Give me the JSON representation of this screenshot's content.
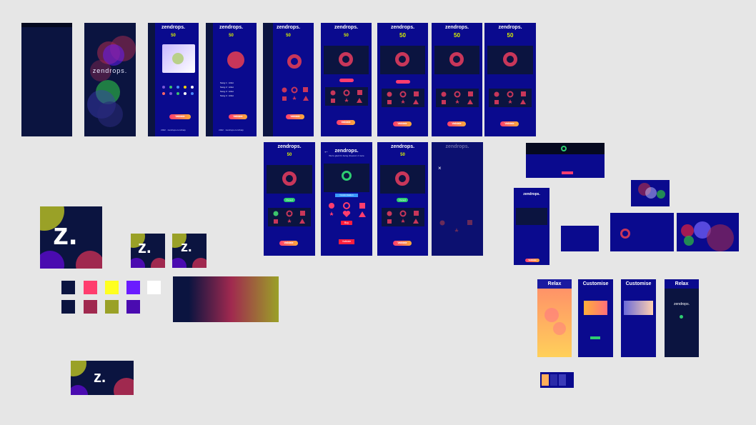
{
  "brand": {
    "name": "zendrops.",
    "logo_letter": "z.",
    "accent": "#0a0a8e",
    "dark": "#0b1440"
  },
  "screens": {
    "coins_small": "50",
    "coins_large": "50",
    "subtitle": "Tap to start falling. Take",
    "buy_label": "Buy",
    "validate_label": "Validate",
    "owned_label": "Owned",
    "footer": "2022 · zendrops.com/help",
    "customise_header": "Customise",
    "customise_header_2": "Customise",
    "relax_header": "Relax",
    "relax_header_2": "Relax",
    "relax_brand": "zendrops.",
    "song_rows": [
      "Song 1 : Artist",
      "Song 2 : Artist",
      "Song 3 : Artist",
      "Song 4 : Artist"
    ],
    "back_subtitle": "We're glad it's being cheered. 2 more",
    "customisation_label": "Customisation"
  },
  "palette": {
    "swatches": [
      "#0b1440",
      "#ff3d6e",
      "#ffff20",
      "#6a1cff",
      "#ffffff",
      "#0b1440",
      "#a0294f",
      "#9aa127",
      "#4a0bb0"
    ]
  },
  "gradient": {
    "from": "#0b1440",
    "mid": "#a0294f",
    "to": "#9aa127"
  }
}
